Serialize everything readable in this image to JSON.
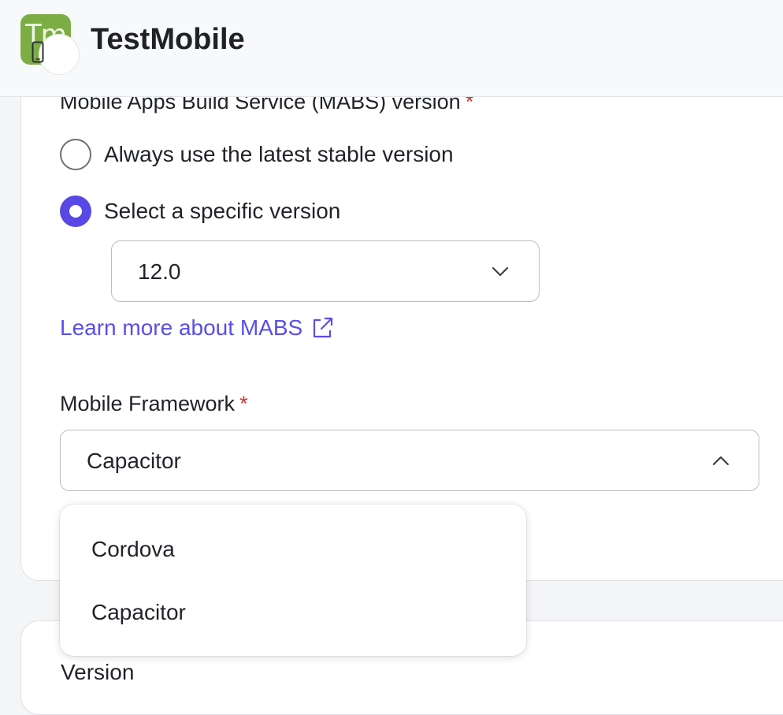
{
  "header": {
    "app_logo_text": "Tm",
    "app_title": "TestMobile"
  },
  "mabs": {
    "label": "Mobile Apps Build Service (MABS) version",
    "required_mark": "*",
    "options": [
      {
        "label": "Always use the latest stable version",
        "checked": false
      },
      {
        "label": "Select a specific version",
        "checked": true
      }
    ],
    "version_select": {
      "value": "12.0",
      "expanded": false
    },
    "learn_more_link": "Learn more about MABS"
  },
  "framework": {
    "label": "Mobile Framework",
    "required_mark": "*",
    "select": {
      "value": "Capacitor",
      "expanded": true
    },
    "dropdown_options": [
      "Cordova",
      "Capacitor"
    ]
  },
  "next_card": {
    "heading": "Version"
  },
  "colors": {
    "accent": "#5849e6",
    "link": "#5a4ee6",
    "required": "#d4342b",
    "logo_bg": "#7cad45"
  },
  "icons": {
    "logo_badge": "mobile-phone-icon",
    "version_select": "chevron-down-icon",
    "framework_select": "chevron-up-icon",
    "learn_more": "external-link-icon"
  }
}
